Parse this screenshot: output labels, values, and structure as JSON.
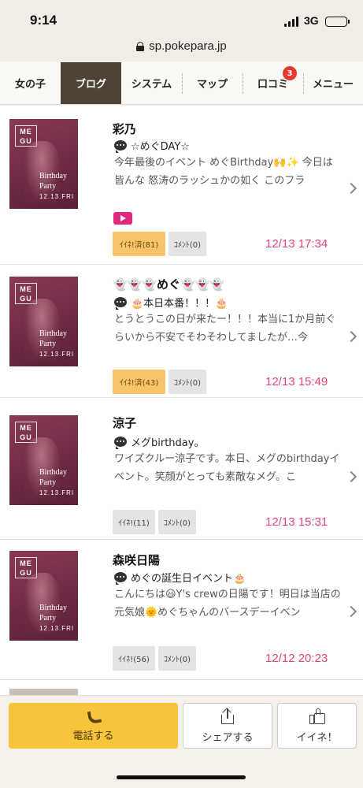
{
  "status_bar": {
    "time": "9:14",
    "network": "3G"
  },
  "browser": {
    "url": "sp.pokepara.jp"
  },
  "nav": {
    "tabs": [
      {
        "label": "女の子"
      },
      {
        "label": "ブログ"
      },
      {
        "label": "システム"
      },
      {
        "label": "マップ"
      },
      {
        "label": "口コミ",
        "badge": "3"
      },
      {
        "label": "メニュー"
      }
    ],
    "active_tab": "ブログ"
  },
  "thumbnail": {
    "logo_line1": "ME",
    "logo_line2": "GU",
    "caption_line1": "Birthday",
    "caption_line2": "Party",
    "caption_date": "12.13.FRI"
  },
  "posts": [
    {
      "name": "彩乃",
      "title": "☆めぐDAY☆",
      "excerpt": "今年最後のイベント めぐBirthday🙌✨ 今日は皆んな 怒涛のラッシュかの如く このフラ",
      "has_video": true,
      "like_label": "ｲｲﾈ!済(81)",
      "liked": true,
      "comment_label": "ｺﾒﾝﾄ(0)",
      "date": "12/13 17:34"
    },
    {
      "name": "👻👻👻めぐ👻👻👻",
      "title": "🎂本日本番！！！🎂",
      "excerpt": "とうとうこの日が来たー！！！本当に1か月前ぐらいから不安でそわそわしてましたが…今",
      "has_video": false,
      "like_label": "ｲｲﾈ!済(43)",
      "liked": true,
      "comment_label": "ｺﾒﾝﾄ(0)",
      "date": "12/13 15:49"
    },
    {
      "name": "涼子",
      "title": "メグbirthday。",
      "excerpt": "ワイズクルー涼子です。本日、メグのbirthdayイベント。笑顔がとっても素敵なメグ。こ",
      "has_video": false,
      "like_label": "ｲｲﾈ!(11)",
      "liked": false,
      "comment_label": "ｺﾒﾝﾄ(0)",
      "date": "12/13 15:31"
    },
    {
      "name": "森咲日陽",
      "title": "めぐの誕生日イベント🎂",
      "excerpt": "こんにちは😃Y's crewの日陽です！明日は当店の元気娘🌞めぐちゃんのバースデーイベン",
      "has_video": false,
      "like_label": "ｲｲﾈ!(56)",
      "liked": false,
      "comment_label": "ｺﾒﾝﾄ(0)",
      "date": "12/12 20:23"
    }
  ],
  "bottom_bar": {
    "call_label": "電話する",
    "share_label": "シェアする",
    "like_label": "イイネ！"
  },
  "colors": {
    "accent_pink": "#e0457a",
    "active_tab": "#4f4237",
    "call_button": "#f7c53b",
    "liked_button": "#f7c46a",
    "badge": "#e8382c"
  }
}
